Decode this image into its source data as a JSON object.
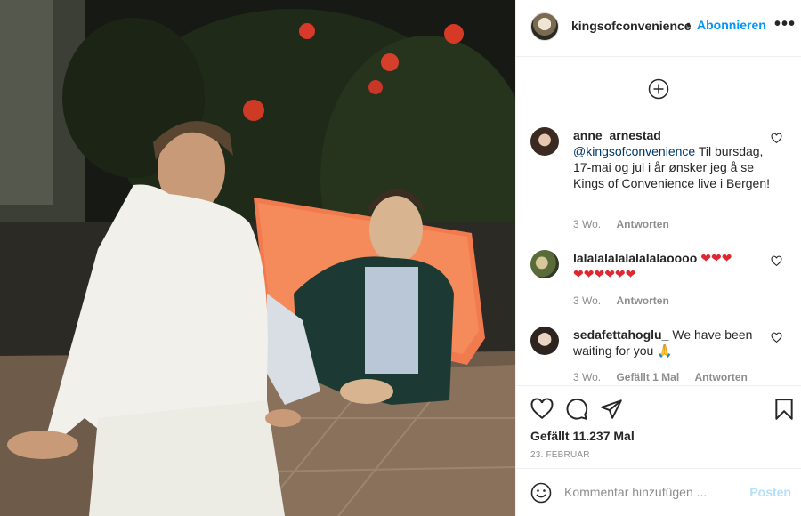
{
  "post": {
    "username": "kingsofconvenience",
    "follow_label": "Abonnieren",
    "more_label": "•••",
    "likes": "Gefällt 11.237 Mal",
    "date": "23. FEBRUAR"
  },
  "comments": [
    {
      "username": "anne_arnestad",
      "mention": "@kingsofconvenience",
      "text": " Til bursdag, 17-mai og jul i år ønsker jeg å se Kings of Convenience live i Bergen!",
      "time": "3 Wo.",
      "reply": "Antworten"
    },
    {
      "username": "lalalalalalalalalaoooo",
      "text": "❤❤❤",
      "text2": "❤❤❤❤❤❤",
      "time": "3 Wo.",
      "reply": "Antworten"
    },
    {
      "username": "sedafettahoglu_",
      "text": "We have been waiting for you 🙏",
      "time": "3 Wo.",
      "likes": "Gefällt 1 Mal",
      "reply": "Antworten"
    }
  ],
  "composer": {
    "placeholder": "Kommentar hinzufügen ...",
    "post_label": "Posten"
  },
  "colors": {
    "link": "#0095f6",
    "heart": "#e0262e"
  }
}
